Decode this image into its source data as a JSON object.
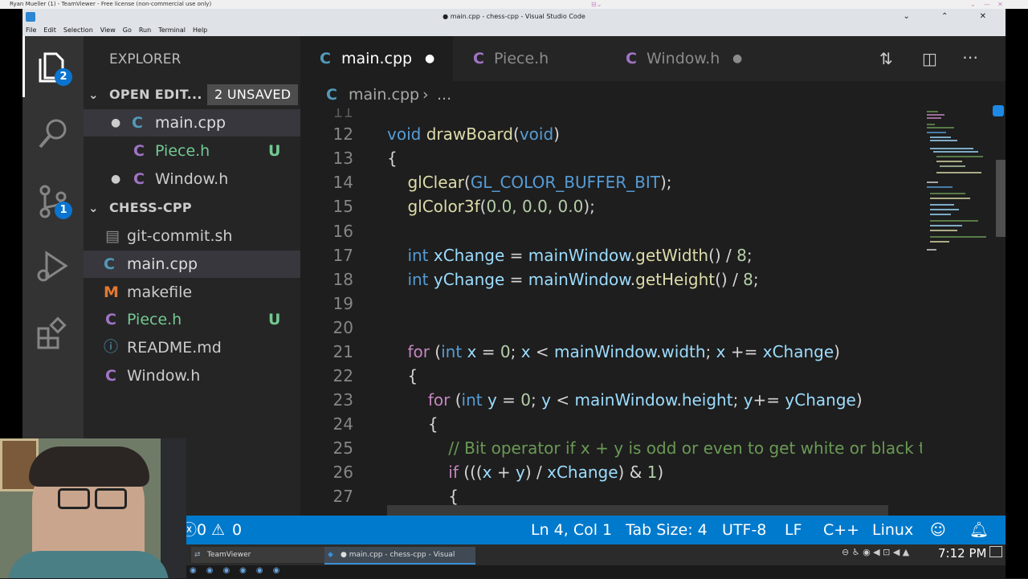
{
  "teamviewer": {
    "title": "Ryan Mueller (1) - TeamViewer - Free license (non-commercial use only)"
  },
  "vscode_title": "● main.cpp - chess-cpp - Visual Studio Code",
  "menu": [
    "File",
    "Edit",
    "Selection",
    "View",
    "Go",
    "Run",
    "Terminal",
    "Help"
  ],
  "activity": {
    "explorer_badge": "2",
    "scm_badge": "1"
  },
  "sidebar": {
    "explorer_title": "EXPLORER",
    "open_editors_title": "OPEN EDIT...",
    "unsaved_label": "2 UNSAVED",
    "open_editors": [
      {
        "name": "main.cpp",
        "status": ""
      },
      {
        "name": "Piece.h",
        "status": "U"
      },
      {
        "name": "Window.h",
        "status": ""
      }
    ],
    "folder_title": "CHESS-CPP",
    "files": [
      {
        "name": "git-commit.sh",
        "status": ""
      },
      {
        "name": "main.cpp",
        "status": ""
      },
      {
        "name": "makefile",
        "status": ""
      },
      {
        "name": "Piece.h",
        "status": "U"
      },
      {
        "name": "README.md",
        "status": ""
      },
      {
        "name": "Window.h",
        "status": ""
      }
    ]
  },
  "tabs": [
    {
      "name": "main.cpp"
    },
    {
      "name": "Piece.h"
    },
    {
      "name": "Window.h"
    }
  ],
  "breadcrumb": {
    "file": "main.cpp",
    "more": "..."
  },
  "code_lines": [
    {
      "num": "12"
    },
    {
      "num": "13"
    },
    {
      "num": "14"
    },
    {
      "num": "15"
    },
    {
      "num": "16"
    },
    {
      "num": "17"
    },
    {
      "num": "18"
    },
    {
      "num": "19"
    },
    {
      "num": "20"
    },
    {
      "num": "21"
    },
    {
      "num": "22"
    },
    {
      "num": "23"
    },
    {
      "num": "24"
    },
    {
      "num": "25"
    },
    {
      "num": "26"
    },
    {
      "num": "27"
    }
  ],
  "code_text": {
    "l12_kw": "void",
    "l12_fn": "drawBoard",
    "l12_arg": "void",
    "l14_fn": "glClear",
    "l14_mac": "GL_COLOR_BUFFER_BIT",
    "l15_fn": "glColor3f",
    "l15_args": "0.0, 0.0, 0.0",
    "l17": {
      "type": "int",
      "var": "xChange",
      "obj": "mainWindow",
      "method": "getWidth",
      "num": "8"
    },
    "l18": {
      "type": "int",
      "var": "yChange",
      "obj": "mainWindow",
      "method": "getHeight",
      "num": "8"
    },
    "l21": {
      "kw": "for",
      "type": "int",
      "var": "x",
      "zero": "0",
      "obj": "mainWindow",
      "prop": "width",
      "step": "xChange"
    },
    "l23": {
      "kw": "for",
      "type": "int",
      "var": "y",
      "zero": "0",
      "obj": "mainWindow",
      "prop": "height",
      "step": "yChange"
    },
    "l25": "// Bit operator if x + y is odd or even to get white or black tiles",
    "l26": {
      "kw": "if",
      "a": "x",
      "b": "y",
      "c": "xChange",
      "d": "1"
    }
  },
  "status": {
    "errors": "0",
    "warnings": "0",
    "position": "Ln 4, Col 1",
    "tab_size": "Tab Size: 4",
    "encoding": "UTF-8",
    "eol": "LF",
    "language": "C++",
    "platform": "Linux"
  },
  "taskbar": {
    "teamviewer_label": "TeamViewer",
    "vscode_label": "● main.cpp - chess-cpp - Visual Stu...",
    "clock": "7:12 PM"
  },
  "colors": {
    "accent": "#007acc",
    "sidebar": "#252526",
    "editor": "#1e1e1e",
    "activity": "#333333"
  }
}
